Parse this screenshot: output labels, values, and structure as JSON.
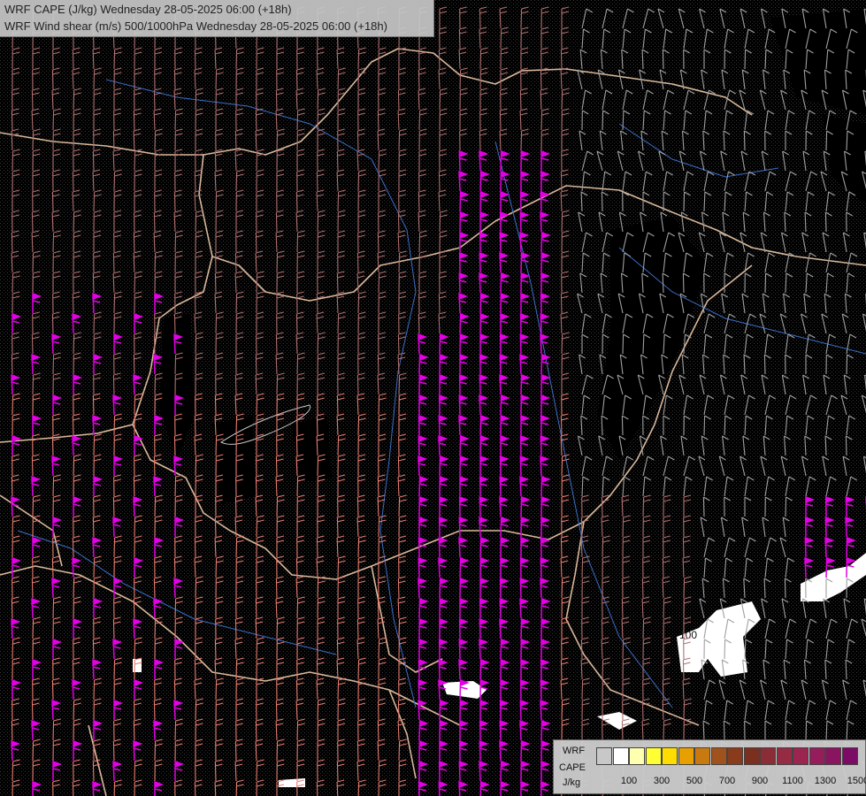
{
  "title": {
    "line1": "WRF CAPE (J/kg) Wednesday 28-05-2025 06:00 (+18h)",
    "line2": "WRF Wind shear (m/s) 500/1000hPa Wednesday 28-05-2025 06:00 (+18h)"
  },
  "legend": {
    "model_label": "WRF",
    "field_label": "CAPE",
    "unit_label": "J/kg",
    "ticks": [
      "100",
      "300",
      "500",
      "700",
      "900",
      "1100",
      "1300",
      "1500"
    ],
    "colors": [
      "#c8c8c8",
      "#ffffff",
      "#ffffb0",
      "#ffff33",
      "#ffdd00",
      "#e8a000",
      "#c87a10",
      "#a0521c",
      "#8a3b1c",
      "#7a2f1f",
      "#8a2d36",
      "#962c44",
      "#9c2550",
      "#951d5c",
      "#8a1460",
      "#7b0b64"
    ]
  },
  "map_labels": {
    "cape_contour": "100"
  },
  "colors": {
    "background": "#000000",
    "border_line": "#d9b89a",
    "river": "#3a6ec8",
    "contour": "#9a9a9a",
    "barb_strong": "#e400e4",
    "barb_moderate": "#e87c70",
    "barb_weak": "#b07070",
    "barb_calm": "#a0a0a0",
    "cape_low": "#ffffff"
  }
}
